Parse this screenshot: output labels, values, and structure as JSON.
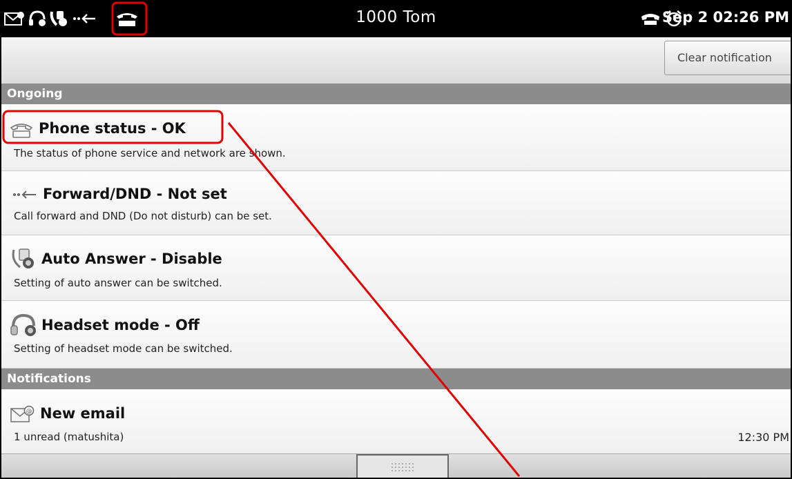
{
  "status_bar": {
    "title": "1000 Tom",
    "datetime": "Sep 2 02:26 PM",
    "icons": [
      "email-icon",
      "headset-icon",
      "auto-answer-icon",
      "forward-icon",
      "phone-status-icon",
      "handset-icon",
      "alarm-icon"
    ]
  },
  "toolbar": {
    "clear_label": "Clear notification"
  },
  "ongoing": {
    "header": "Ongoing",
    "items": [
      {
        "icon": "phone-status-icon",
        "title": "Phone status - OK",
        "subtitle": "The status of phone service and network are shown."
      },
      {
        "icon": "forward-icon",
        "title": "Forward/DND - Not set",
        "subtitle": "Call forward and DND (Do not disturb) can be set."
      },
      {
        "icon": "auto-answer-icon",
        "title": "Auto Answer - Disable",
        "subtitle": "Setting of auto answer can be switched."
      },
      {
        "icon": "headset-icon",
        "title": "Headset mode - Off",
        "subtitle": "Setting of headset mode can be switched."
      }
    ]
  },
  "notifications": {
    "header": "Notifications",
    "items": [
      {
        "icon": "email-icon",
        "title": "New email",
        "subtitle": "1 unread (matushita)",
        "time": "12:30 PM"
      }
    ]
  },
  "annotation_color": "#e00000"
}
